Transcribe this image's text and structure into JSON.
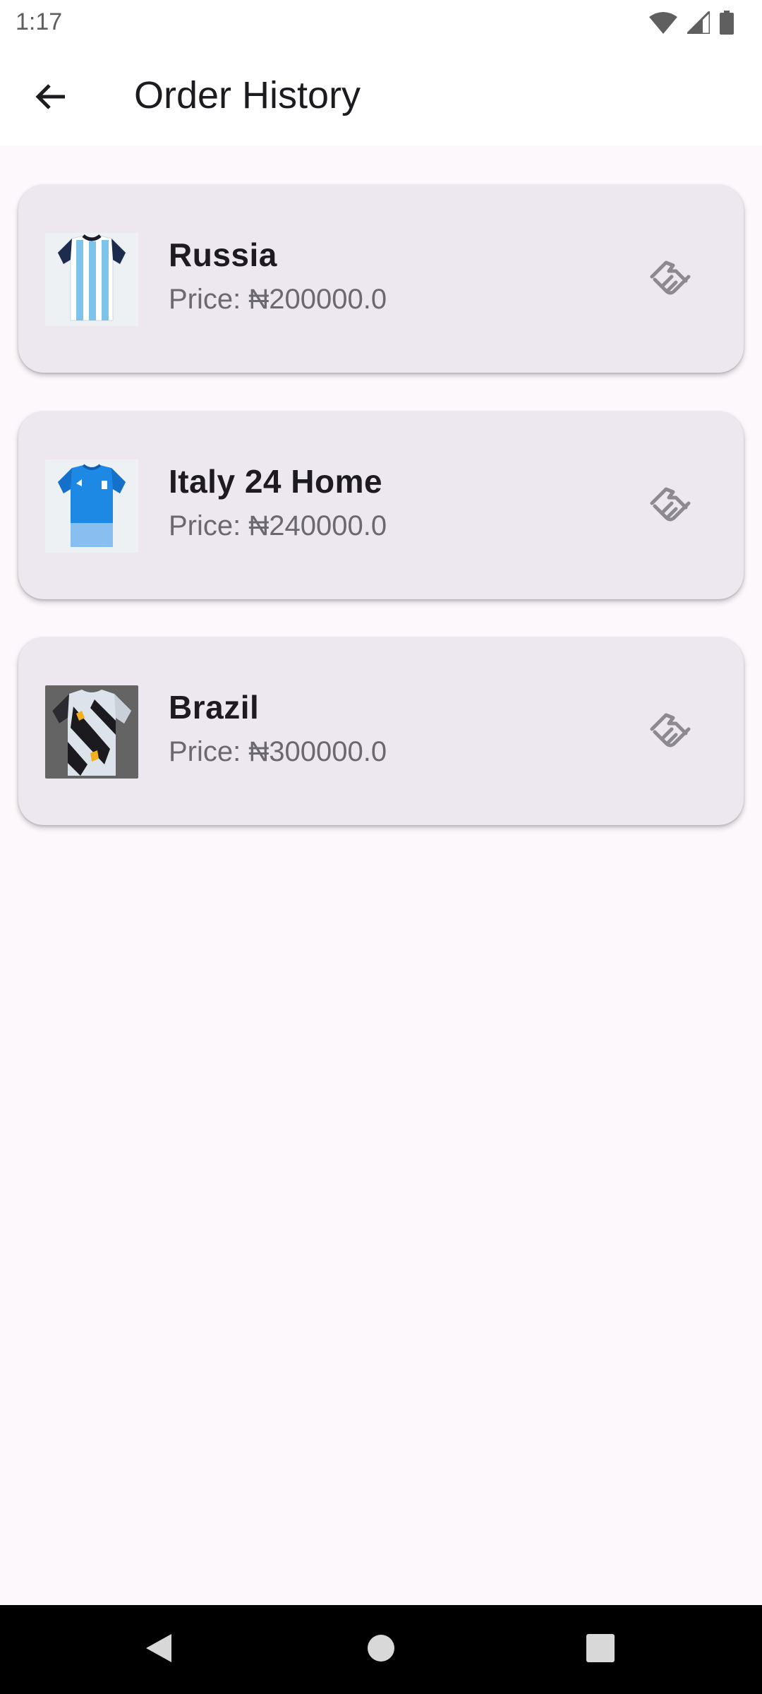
{
  "status_bar": {
    "time": "1:17"
  },
  "app_bar": {
    "title": "Order History"
  },
  "orders": [
    {
      "name": "Russia",
      "price": "Price: ₦200000.0",
      "image": "white-sky-blue-striped-jersey"
    },
    {
      "name": "Italy 24 Home",
      "price": "Price: ₦240000.0",
      "image": "blue-jersey"
    },
    {
      "name": "Brazil",
      "price": "Price: ₦300000.0",
      "image": "grey-black-yellow-jersey"
    }
  ],
  "icons": {
    "back": "arrow-back-icon",
    "order_action": "handshake-icon",
    "wifi": "wifi-icon",
    "signal": "signal-icon",
    "battery": "battery-icon"
  },
  "colors": {
    "background": "#fdf8fc",
    "card": "#ede7f0",
    "title_text": "#1d1b20",
    "secondary_text": "#6c6870",
    "icon_grey": "#8d8990"
  }
}
